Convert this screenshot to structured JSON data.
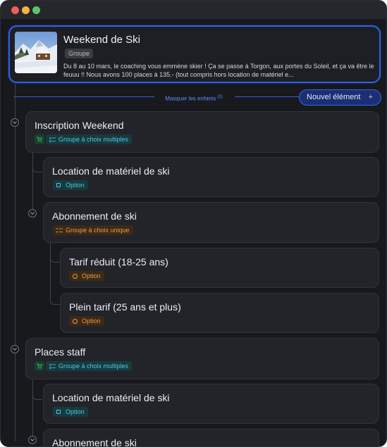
{
  "window": {
    "controls": [
      "close",
      "minimize",
      "zoom"
    ]
  },
  "root": {
    "title": "Weekend de Ski",
    "tag": "Groupe",
    "description": "Du 8 au 10 mars, le coaching vous emmène skier ! Ça se passe à Torgon, aux portes du Soleil, et ça va être le feuuu !! Nous avons 100 places à 135.- (tout compris hors location de matériel e...",
    "image": "snowy-mountain-chalet-thumbnail"
  },
  "toolbar": {
    "hide_children_label": "Masquer les enfants",
    "hide_children_count": "(2)",
    "new_element_label": "Nouvel élément",
    "new_element_icon": "+"
  },
  "nodes": [
    {
      "title": "Inscription Weekend",
      "badge": "Groupe à choix multiples",
      "cart_icon": "cart-icon"
    },
    {
      "title": "Location de matériel de ski",
      "badge": "Option"
    },
    {
      "title": "Abonnement de ski",
      "badge": "Groupe à choix unique"
    },
    {
      "title": "Tarif réduit (18-25 ans)",
      "badge": "Option"
    },
    {
      "title": "Plein tarif (25 ans et plus)",
      "badge": "Option"
    },
    {
      "title": "Places staff",
      "badge": "Groupe à choix multiples",
      "cart_icon": "cart-icon"
    },
    {
      "title": "Location de matériel de ski",
      "badge": "Option"
    },
    {
      "title": "Abonnement de ski",
      "badge": ""
    }
  ],
  "colors": {
    "accent": "#2f5fe8",
    "multi_badge": "#56c6d8",
    "unique_badge": "#e79d4a",
    "cart_green": "#3fb56a"
  }
}
